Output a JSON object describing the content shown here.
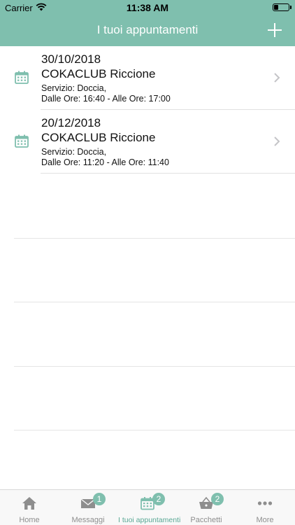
{
  "status_bar": {
    "carrier": "Carrier",
    "time": "11:38 AM"
  },
  "header": {
    "title": "I tuoi appuntamenti",
    "add_icon": "plus-icon"
  },
  "appointments": [
    {
      "date": "30/10/2018",
      "place": "COKACLUB Riccione",
      "service": "Servizio: Doccia,",
      "times": "Dalle Ore: 16:40 - Alle Ore: 17:00"
    },
    {
      "date": "20/12/2018",
      "place": "COKACLUB Riccione",
      "service": "Servizio: Doccia,",
      "times": "Dalle Ore: 11:20 - Alle Ore: 11:40"
    }
  ],
  "tabs": [
    {
      "label": "Home",
      "icon": "home-icon",
      "badge": ""
    },
    {
      "label": "Messaggi",
      "icon": "envelope-icon",
      "badge": "1"
    },
    {
      "label": "I tuoi appuntamenti",
      "icon": "calendar-icon",
      "badge": "2",
      "active": true
    },
    {
      "label": "Pacchetti",
      "icon": "basket-icon",
      "badge": "2"
    },
    {
      "label": "More",
      "icon": "more-dots-icon",
      "badge": ""
    }
  ],
  "colors": {
    "accent": "#7fbfae",
    "tab_inactive": "#8e8e8e",
    "tab_active": "#5aa895"
  }
}
